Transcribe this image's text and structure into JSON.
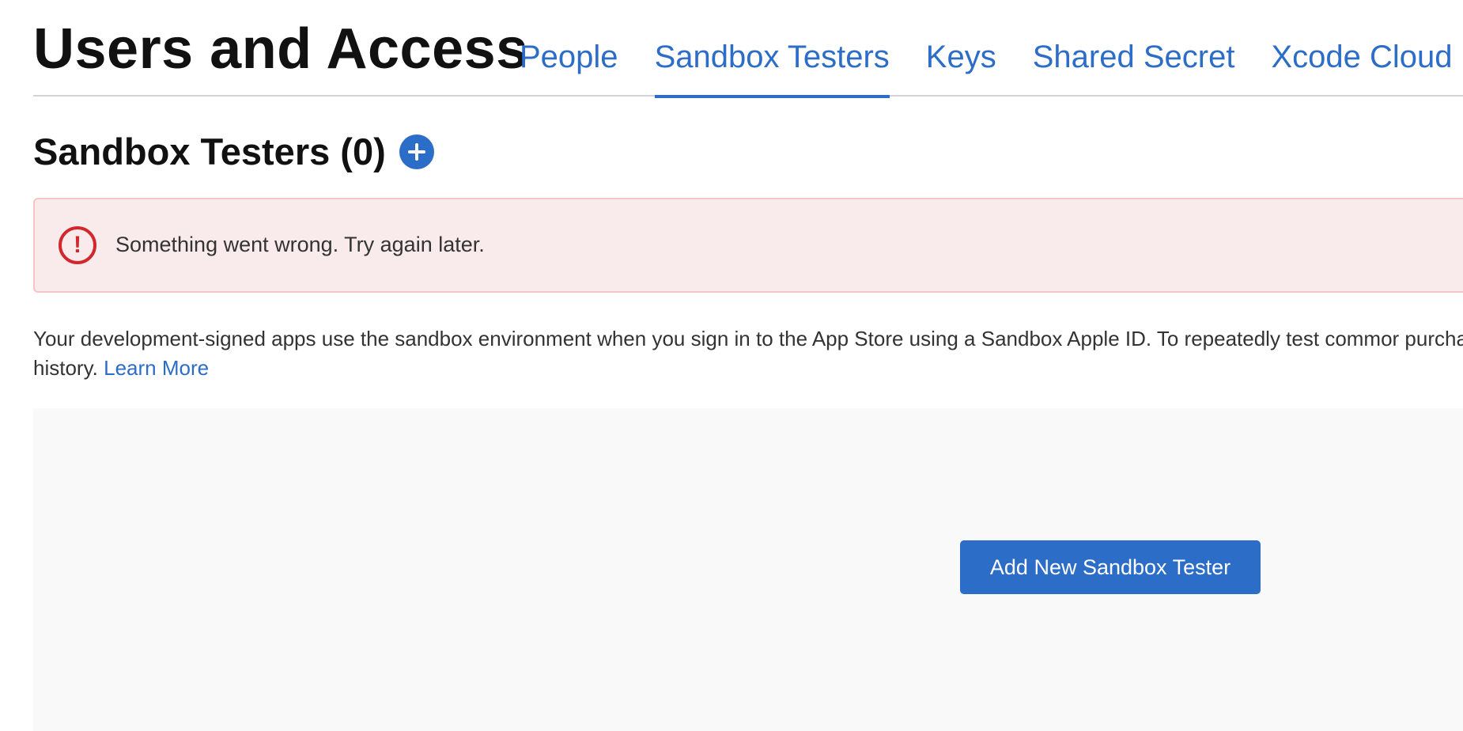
{
  "header": {
    "title": "Users and Access",
    "tabs": [
      {
        "label": "People",
        "active": false
      },
      {
        "label": "Sandbox Testers",
        "active": true
      },
      {
        "label": "Keys",
        "active": false
      },
      {
        "label": "Shared Secret",
        "active": false
      },
      {
        "label": "Xcode Cloud",
        "active": false
      }
    ]
  },
  "section": {
    "title": "Sandbox Testers (0)",
    "add_icon": "plus-circle-icon"
  },
  "error": {
    "icon": "exclamation-circle-icon",
    "message": "Something went wrong. Try again later."
  },
  "description": {
    "text": "Your development-signed apps use the sandbox environment when you sign in to the App Store using a Sandbox Apple ID. To repeatedly test commor purchase history.",
    "learn_more": "Learn More"
  },
  "empty_state": {
    "button_label": "Add New Sandbox Tester"
  },
  "colors": {
    "accent": "#2c6dc7",
    "error": "#d1282e",
    "error_background": "#f9ebeb",
    "panel_background": "#f9f9f9"
  }
}
